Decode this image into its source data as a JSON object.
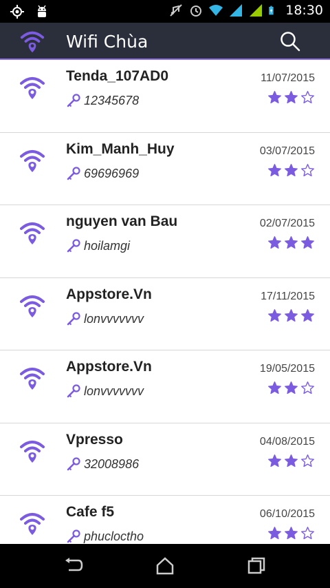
{
  "status_bar": {
    "time": "18:30",
    "icons": [
      "gps-icon",
      "android-debug-icon",
      "mute-icon",
      "alarm-icon",
      "wifi-icon",
      "signal-icon",
      "signal-icon",
      "battery-icon"
    ]
  },
  "app_bar": {
    "title": "Wifi Chùa",
    "logo_icon": "wifi-location-icon",
    "action_icon": "search-icon"
  },
  "colors": {
    "accent": "#7b5ce0",
    "app_bar_bg": "#2b2f3b",
    "divider": "#d6d6d6"
  },
  "networks": [
    {
      "name": "Tenda_107AD0",
      "password": "12345678",
      "date": "11/07/2015",
      "rating": 2
    },
    {
      "name": "Kim_Manh_Huy",
      "password": "69696969",
      "date": "03/07/2015",
      "rating": 2
    },
    {
      "name": "nguyen van Bau",
      "password": "hoilamgi",
      "date": "02/07/2015",
      "rating": 3
    },
    {
      "name": "Appstore.Vn",
      "password": "lonvvvvvvv",
      "date": "17/11/2015",
      "rating": 3
    },
    {
      "name": "Appstore.Vn",
      "password": "lonvvvvvvv",
      "date": "19/05/2015",
      "rating": 2
    },
    {
      "name": "Vpresso",
      "password": "32008986",
      "date": "04/08/2015",
      "rating": 2
    },
    {
      "name": "Cafe f5",
      "password": "phucloctho",
      "date": "06/10/2015",
      "rating": 2
    }
  ],
  "rating_max": 3,
  "nav_bar": {
    "buttons": [
      "back-icon",
      "home-icon",
      "recent-apps-icon"
    ]
  }
}
